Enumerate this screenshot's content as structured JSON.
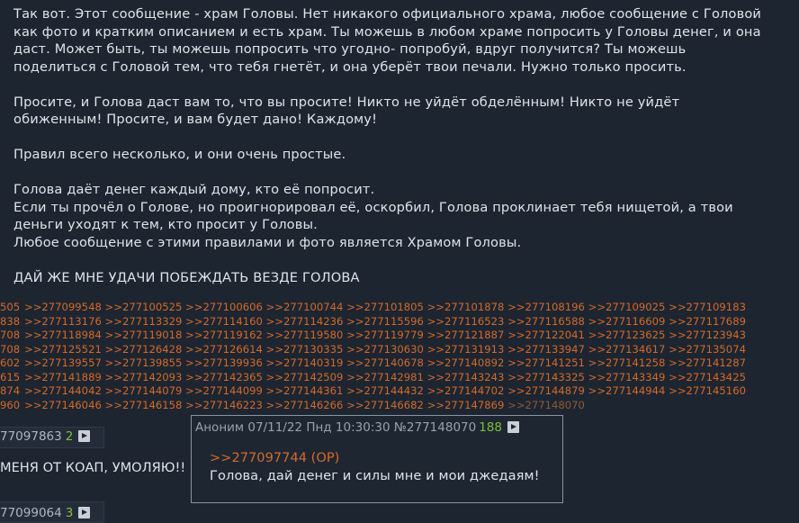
{
  "post": {
    "paragraphs": [
      "Так вот. Этот сообщение - храм Головы. Нет никакого официального храма, любое сообщение с Головой\nкак фото и кратким описанием и есть храм. Ты можешь в любом храме попросить у Головы денег, и она\nдаст. Может быть, ты можешь попросить что угодно- попробуй, вдруг получится? Ты можешь\nподелиться с Головой тем, что тебя гнетёт, и она уберёт твои печали. Нужно только просить.",
      "Просите, и Голова даст вам то, что вы просите! Никто не уйдёт обделённым! Никто не уйдёт\nобиженным! Просите, и вам будет дано! Каждому!",
      "Правил всего несколько, и они очень простые.",
      "Голова даёт денег каждый дому, кто её попросит.\nЕсли ты прочёл о Голове, но проигнорировал её, оскорбил, Голова проклинает тебя нищетой, а твои\nденьги уходят к тем, кто просит у Головы.\nЛюбое сообщение с этими правилами и фото является Храмом Головы.",
      "ДАЙ ЖЕ МНЕ УДАЧИ ПОБЕЖДАТЬ ВЕЗДЕ ГОЛОВА"
    ]
  },
  "replies": [
    {
      "lead": "505",
      "links": [
        ">>277099548",
        ">>277100525",
        ">>277100606",
        ">>277100744",
        ">>277101805",
        ">>277101878",
        ">>277108196",
        ">>277109025",
        ">>277109183"
      ]
    },
    {
      "lead": "838",
      "links": [
        ">>277113176",
        ">>277113329",
        ">>277114160",
        ">>277114236",
        ">>277115596",
        ">>277116523",
        ">>277116588",
        ">>277116609",
        ">>277117689"
      ]
    },
    {
      "lead": "708",
      "links": [
        ">>277118984",
        ">>277119018",
        ">>277119162",
        ">>277119580",
        ">>277119779",
        ">>277121887",
        ">>277122041",
        ">>277123625",
        ">>277123943"
      ]
    },
    {
      "lead": "708",
      "links": [
        ">>277125521",
        ">>277126428",
        ">>277126614",
        ">>277130335",
        ">>277130630",
        ">>277131913",
        ">>277133947",
        ">>277134617",
        ">>277135074"
      ]
    },
    {
      "lead": "602",
      "links": [
        ">>277139557",
        ">>277139855",
        ">>277139936",
        ">>277140319",
        ">>277140678",
        ">>277140892",
        ">>277141251",
        ">>277141258",
        ">>277141287"
      ]
    },
    {
      "lead": "615",
      "links": [
        ">>277141889",
        ">>277142093",
        ">>277142365",
        ">>277142509",
        ">>277142981",
        ">>277143243",
        ">>277143325",
        ">>277143349",
        ">>277143425"
      ]
    },
    {
      "lead": "874",
      "links": [
        ">>277144042",
        ">>277144079",
        ">>277144099",
        ">>277144361",
        ">>277144432",
        ">>277144702",
        ">>277144879",
        ">>277144944",
        ">>277145160"
      ]
    },
    {
      "lead": "960",
      "links": [
        ">>277146046",
        ">>277146158",
        ">>277146223",
        ">>277146266",
        ">>277146682",
        ">>277147869",
        ">>277148070"
      ]
    }
  ],
  "stub1": {
    "num": "77097863",
    "count": "2",
    "text": "МЕНЯ ОТ КОАП, УМОЛЯЮ!!"
  },
  "stub2": {
    "num": "77099064",
    "count": "3"
  },
  "popup": {
    "author": "Аноним",
    "datetime": "07/11/22 Пнд 10:30:30",
    "num": "№277148070",
    "count": "188",
    "quote": ">>277097744 (OP)",
    "body": "Голова, дай денег и силы мне и мои джедаям!"
  }
}
